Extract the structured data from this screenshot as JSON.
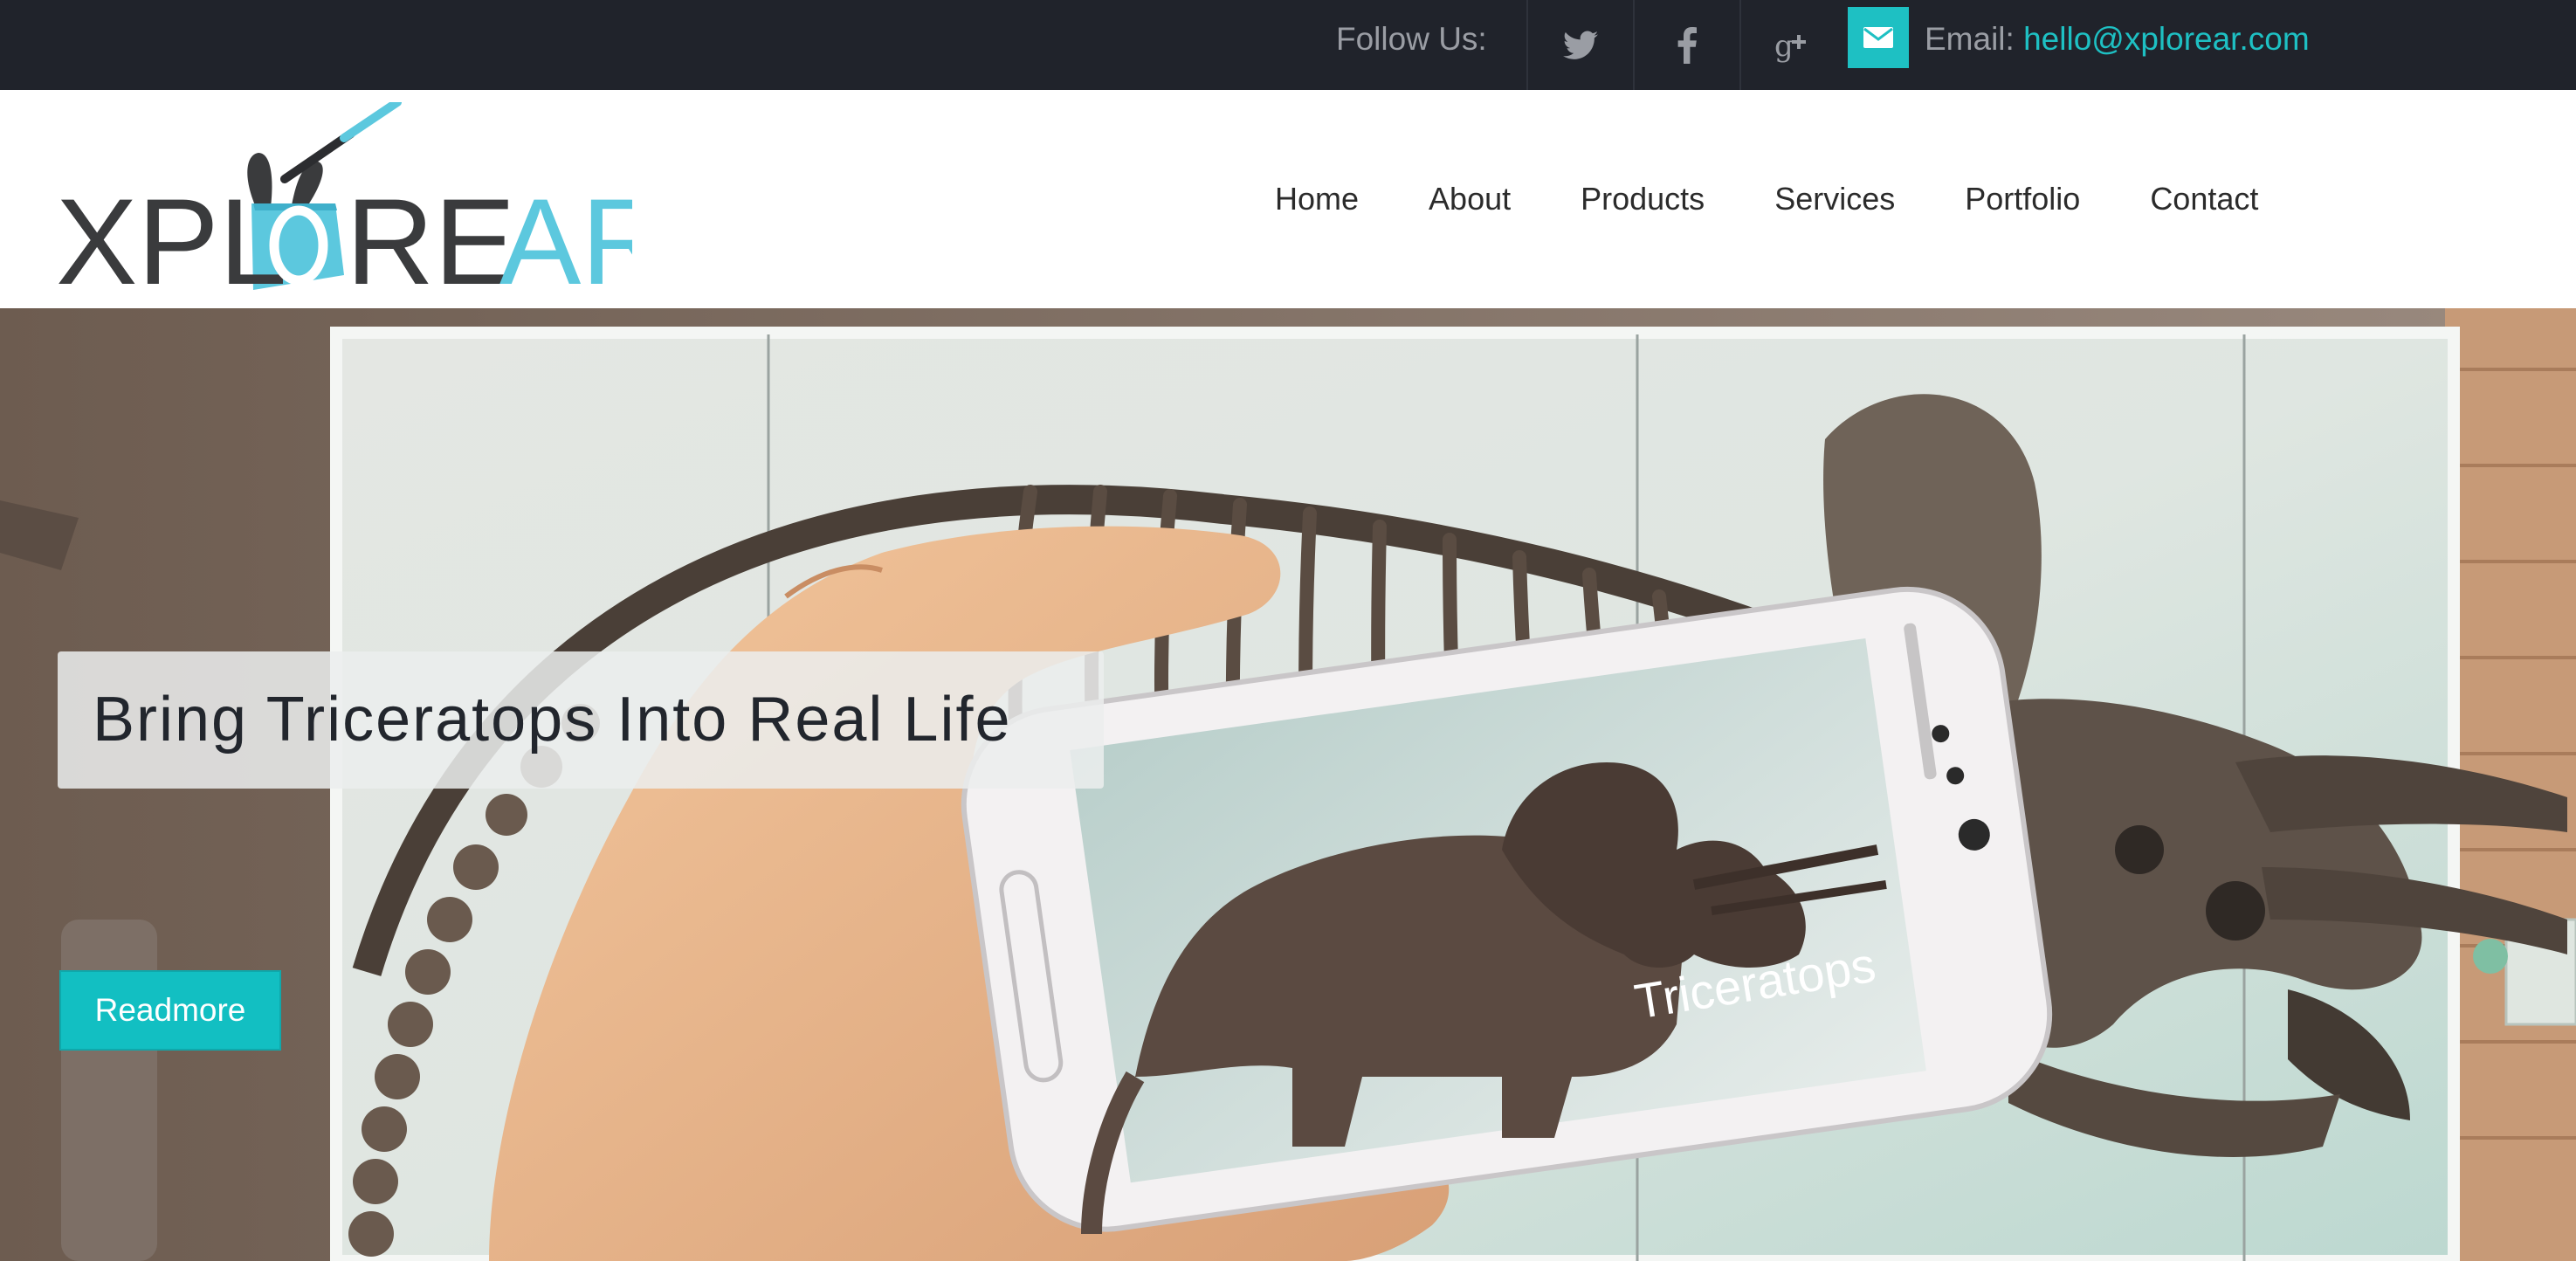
{
  "topbar": {
    "follow_label": "Follow Us:",
    "social": [
      "twitter-icon",
      "facebook-icon",
      "google-plus-icon"
    ],
    "email_label": "Email:",
    "email_address": "hello@xplorear.com"
  },
  "logo": {
    "text": "XPLOREAR"
  },
  "nav": {
    "items": [
      "Home",
      "About",
      "Products",
      "Services",
      "Portfolio",
      "Contact"
    ]
  },
  "hero": {
    "title": "Bring Triceratops Into Real Life",
    "button_label": "Readmore",
    "phone_label": "Triceratops"
  },
  "colors": {
    "accent": "#1ec0c3",
    "topbar_bg": "#20232b",
    "nav_text": "#2b2b2b"
  }
}
